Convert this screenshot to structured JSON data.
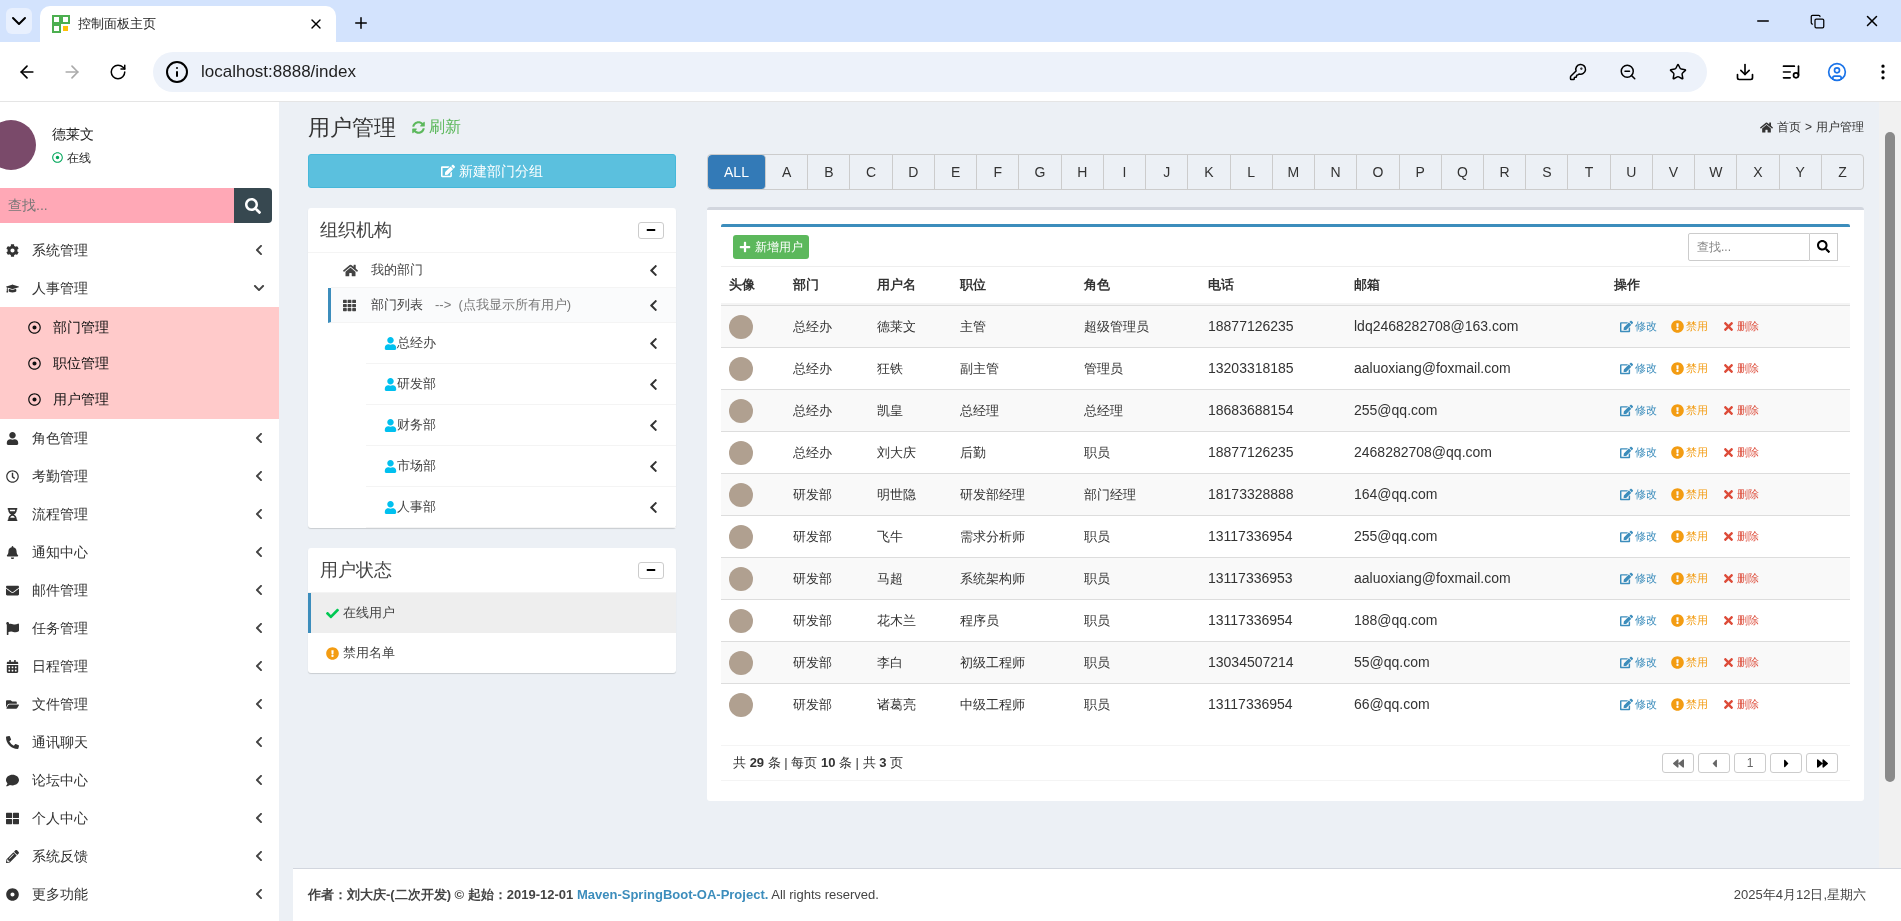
{
  "browser": {
    "tab_title": "控制面板主页",
    "url": "localhost:8888/index"
  },
  "sidebar": {
    "user": {
      "name": "德莱文",
      "status": "在线"
    },
    "search": {
      "placeholder": "查找..."
    },
    "menu": [
      {
        "label": "系统管理",
        "expanded": false
      },
      {
        "label": "人事管理",
        "expanded": true,
        "children": [
          {
            "label": "部门管理"
          },
          {
            "label": "职位管理"
          },
          {
            "label": "用户管理"
          }
        ]
      },
      {
        "label": "角色管理",
        "expanded": false
      },
      {
        "label": "考勤管理",
        "expanded": false
      },
      {
        "label": "流程管理",
        "expanded": false
      },
      {
        "label": "通知中心",
        "expanded": false
      },
      {
        "label": "邮件管理",
        "expanded": false
      },
      {
        "label": "任务管理",
        "expanded": false
      },
      {
        "label": "日程管理",
        "expanded": false
      },
      {
        "label": "文件管理",
        "expanded": false
      },
      {
        "label": "通讯聊天",
        "expanded": false
      },
      {
        "label": "论坛中心",
        "expanded": false
      },
      {
        "label": "个人中心",
        "expanded": false
      },
      {
        "label": "系统反馈",
        "expanded": false
      },
      {
        "label": "更多功能",
        "expanded": false
      }
    ]
  },
  "header": {
    "title": "用户管理",
    "refresh": "刷新",
    "breadcrumb": {
      "home": "首页",
      "separator": ">",
      "current": "用户管理"
    }
  },
  "new_group_button": "新建部门分组",
  "org_panel": {
    "title": "组织机构",
    "items": [
      {
        "kind": "home",
        "label": "我的部门",
        "selected": false
      },
      {
        "kind": "list",
        "label": "部门列表",
        "note": "-->  (点我显示所有用户)",
        "selected": true,
        "children": [
          {
            "label": "总经办"
          },
          {
            "label": "研发部"
          },
          {
            "label": "财务部"
          },
          {
            "label": "市场部"
          },
          {
            "label": "人事部"
          }
        ]
      }
    ]
  },
  "status_panel": {
    "title": "用户状态",
    "items": [
      {
        "kind": "online",
        "label": "在线用户",
        "selected": true
      },
      {
        "kind": "banned",
        "label": "禁用名单",
        "selected": false
      }
    ]
  },
  "letters": [
    {
      "label": "ALL",
      "selected": true
    },
    {
      "label": "A",
      "selected": false
    },
    {
      "label": "B",
      "selected": false
    },
    {
      "label": "C",
      "selected": false
    },
    {
      "label": "D",
      "selected": false
    },
    {
      "label": "E",
      "selected": false
    },
    {
      "label": "F",
      "selected": false
    },
    {
      "label": "G",
      "selected": false
    },
    {
      "label": "H",
      "selected": false
    },
    {
      "label": "I",
      "selected": false
    },
    {
      "label": "J",
      "selected": false
    },
    {
      "label": "K",
      "selected": false
    },
    {
      "label": "L",
      "selected": false
    },
    {
      "label": "M",
      "selected": false
    },
    {
      "label": "N",
      "selected": false
    },
    {
      "label": "O",
      "selected": false
    },
    {
      "label": "P",
      "selected": false
    },
    {
      "label": "Q",
      "selected": false
    },
    {
      "label": "R",
      "selected": false
    },
    {
      "label": "S",
      "selected": false
    },
    {
      "label": "T",
      "selected": false
    },
    {
      "label": "U",
      "selected": false
    },
    {
      "label": "V",
      "selected": false
    },
    {
      "label": "W",
      "selected": false
    },
    {
      "label": "X",
      "selected": false
    },
    {
      "label": "Y",
      "selected": false
    },
    {
      "label": "Z",
      "selected": false
    }
  ],
  "table": {
    "add_button": "新增用户",
    "search": {
      "placeholder": "查找..."
    },
    "columns": [
      "头像",
      "部门",
      "用户名",
      "职位",
      "角色",
      "电话",
      "邮箱",
      "操作"
    ],
    "rows": [
      {
        "department": "总经办",
        "username": "德莱文",
        "position": "主管",
        "role": "超级管理员",
        "phone": "18877126235",
        "email": "ldq2468282708@163.com",
        "actions": [
          {
            "kind": "edit",
            "label": "修改"
          },
          {
            "kind": "disable",
            "label": "禁用"
          },
          {
            "kind": "delete",
            "label": "删除"
          }
        ]
      },
      {
        "department": "总经办",
        "username": "狂铁",
        "position": "副主管",
        "role": "管理员",
        "phone": "13203318185",
        "email": "aaluoxiang@foxmail.com",
        "actions": [
          {
            "kind": "edit",
            "label": "修改"
          },
          {
            "kind": "disable",
            "label": "禁用"
          },
          {
            "kind": "delete",
            "label": "删除"
          }
        ]
      },
      {
        "department": "总经办",
        "username": "凯皇",
        "position": "总经理",
        "role": "总经理",
        "phone": "18683688154",
        "email": "255@qq.com",
        "actions": [
          {
            "kind": "edit",
            "label": "修改"
          },
          {
            "kind": "disable",
            "label": "禁用"
          },
          {
            "kind": "delete",
            "label": "删除"
          }
        ]
      },
      {
        "department": "总经办",
        "username": "刘大庆",
        "position": "后勤",
        "role": "职员",
        "phone": "18877126235",
        "email": "2468282708@qq.com",
        "actions": [
          {
            "kind": "edit",
            "label": "修改"
          },
          {
            "kind": "disable",
            "label": "禁用"
          },
          {
            "kind": "delete",
            "label": "删除"
          }
        ]
      },
      {
        "department": "研发部",
        "username": "明世隐",
        "position": "研发部经理",
        "role": "部门经理",
        "phone": "18173328888",
        "email": "164@qq.com",
        "actions": [
          {
            "kind": "edit",
            "label": "修改"
          },
          {
            "kind": "disable",
            "label": "禁用"
          },
          {
            "kind": "delete",
            "label": "删除"
          }
        ]
      },
      {
        "department": "研发部",
        "username": "飞牛",
        "position": "需求分析师",
        "role": "职员",
        "phone": "13117336954",
        "email": "255@qq.com",
        "actions": [
          {
            "kind": "edit",
            "label": "修改"
          },
          {
            "kind": "disable",
            "label": "禁用"
          },
          {
            "kind": "delete",
            "label": "删除"
          }
        ]
      },
      {
        "department": "研发部",
        "username": "马超",
        "position": "系统架构师",
        "role": "职员",
        "phone": "13117336953",
        "email": "aaluoxiang@foxmail.com",
        "actions": [
          {
            "kind": "edit",
            "label": "修改"
          },
          {
            "kind": "disable",
            "label": "禁用"
          },
          {
            "kind": "delete",
            "label": "删除"
          }
        ]
      },
      {
        "department": "研发部",
        "username": "花木兰",
        "position": "程序员",
        "role": "职员",
        "phone": "13117336954",
        "email": "188@qq.com",
        "actions": [
          {
            "kind": "edit",
            "label": "修改"
          },
          {
            "kind": "disable",
            "label": "禁用"
          },
          {
            "kind": "delete",
            "label": "删除"
          }
        ]
      },
      {
        "department": "研发部",
        "username": "李白",
        "position": "初级工程师",
        "role": "职员",
        "phone": "13034507214",
        "email": "55@qq.com",
        "actions": [
          {
            "kind": "edit",
            "label": "修改"
          },
          {
            "kind": "disable",
            "label": "禁用"
          },
          {
            "kind": "delete",
            "label": "删除"
          }
        ]
      },
      {
        "department": "研发部",
        "username": "诸葛亮",
        "position": "中级工程师",
        "role": "职员",
        "phone": "13117336954",
        "email": "66@qq.com",
        "actions": [
          {
            "kind": "edit",
            "label": "修改"
          },
          {
            "kind": "disable",
            "label": "禁用"
          },
          {
            "kind": "delete",
            "label": "删除"
          }
        ]
      }
    ],
    "pagination": {
      "summary": "共 **29** 条 | 每页 **10** 条 | 共 **3** 页",
      "current_page": "1"
    }
  },
  "footer": {
    "credit": "作者：刘大庆-(二次开发) © 起始：2019-12-01",
    "link": "Maven-SpringBoot-OA-Project.",
    "suffix": "All rights reserved.",
    "date": "2025年4月12日,星期六"
  }
}
